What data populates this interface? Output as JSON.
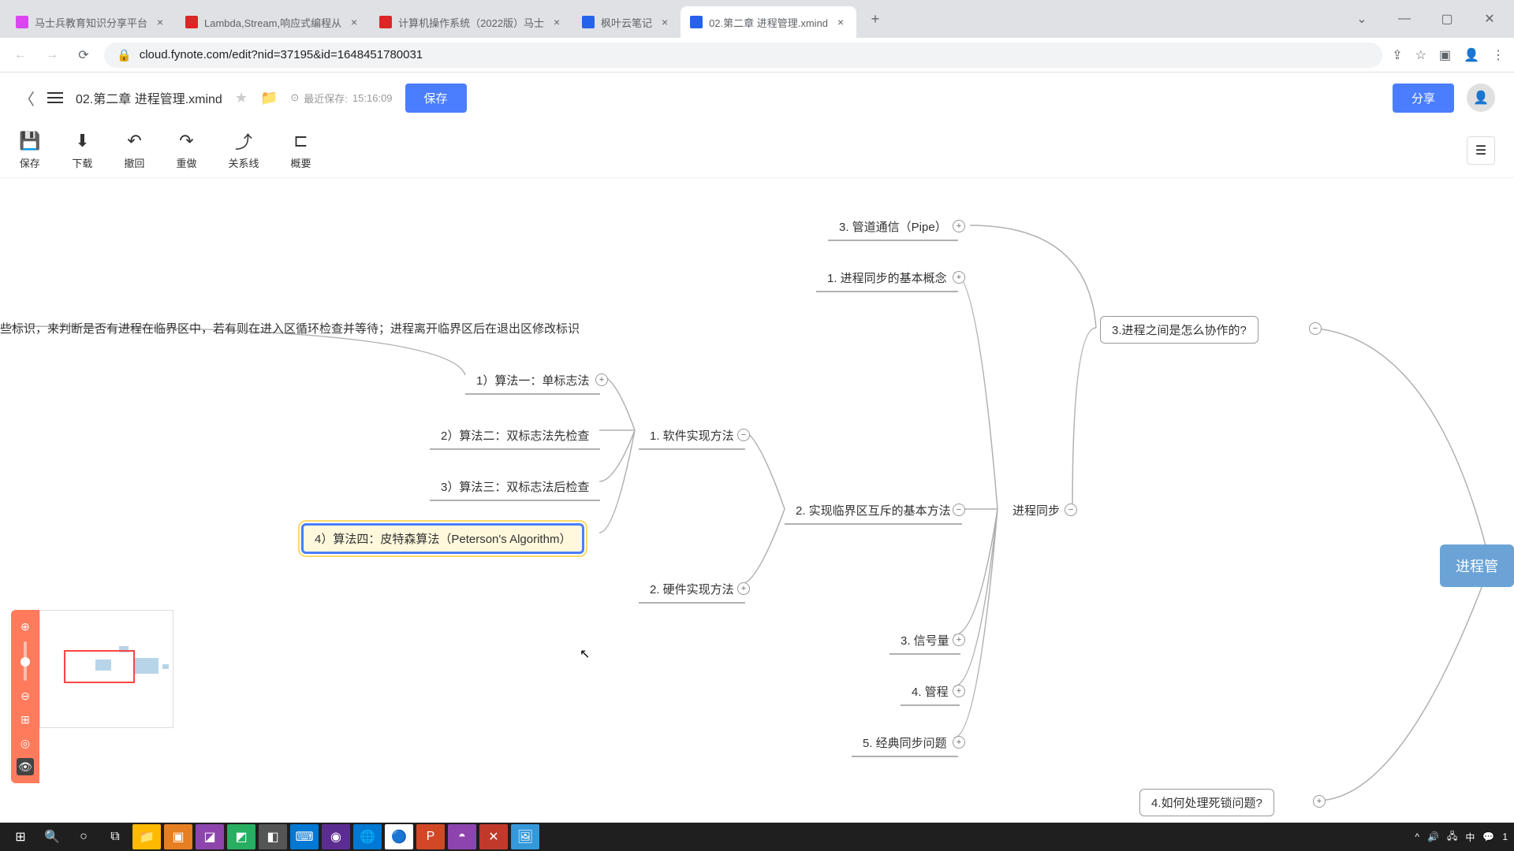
{
  "browser": {
    "tabs": [
      {
        "title": "马士兵教育知识分享平台",
        "icon_color": "#d946ef"
      },
      {
        "title": "Lambda,Stream,响应式编程从",
        "icon_color": "#dc2626"
      },
      {
        "title": "计算机操作系统（2022版）马士",
        "icon_color": "#dc2626"
      },
      {
        "title": "枫叶云笔记",
        "icon_color": "#2563eb"
      },
      {
        "title": "02.第二章 进程管理.xmind",
        "icon_color": "#2563eb",
        "active": true
      }
    ],
    "url": "cloud.fynote.com/edit?nid=37195&id=1648451780031"
  },
  "header": {
    "doc_title": "02.第二章 进程管理.xmind",
    "save_time_label": "最近保存:",
    "save_time": "15:16:09",
    "save_btn": "保存",
    "share_btn": "分享"
  },
  "toolbar": {
    "save": "保存",
    "download": "下载",
    "undo": "撤回",
    "redo": "重做",
    "relation": "关系线",
    "summary": "概要"
  },
  "mindmap": {
    "description": "些标识，来判断是否有进程在临界区中，若有则在进入区循环检查并等待；进程离开临界区后在退出区修改标识",
    "root": "进程管",
    "n_coop": "3.进程之间是怎么协作的?",
    "n_deadlock": "4.如何处理死锁问题?",
    "n_sync": "进程同步",
    "n_pipe": "3. 管道通信（Pipe）",
    "n_concept": "1. 进程同步的基本概念",
    "n_mutex": "2. 实现临界区互斥的基本方法",
    "n_sem": "3. 信号量",
    "n_mon": "4. 管程",
    "n_classic": "5. 经典同步问题",
    "n_soft": "1. 软件实现方法",
    "n_hard": "2. 硬件实现方法",
    "n_a1": "1）算法一：单标志法",
    "n_a2": "2）算法二：双标志法先检查",
    "n_a3": "3）算法三：双标志法后检查",
    "n_a4": "4）算法四：皮特森算法（Peterson's Algorithm）"
  },
  "taskbar": {
    "time": "1"
  }
}
